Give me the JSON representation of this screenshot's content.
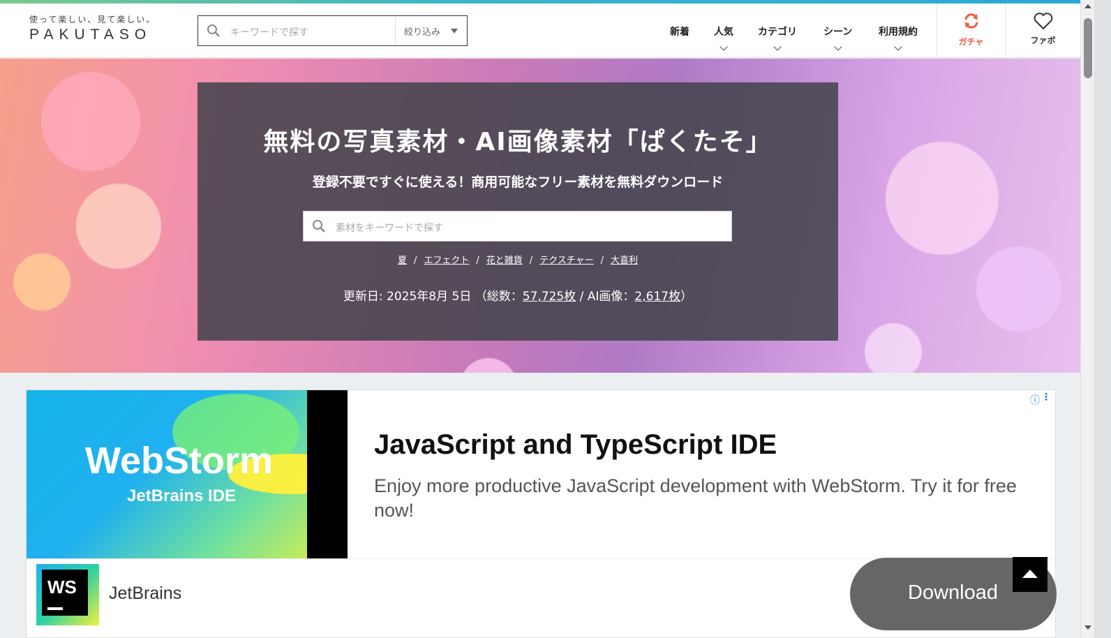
{
  "header": {
    "logo_tagline": "使って楽しい、見て楽しい。",
    "logo_name": "PAKUTASO",
    "search_placeholder": "キーワードで探す",
    "filter_label": "絞り込み",
    "nav": [
      {
        "label": "新着",
        "has_dropdown": false
      },
      {
        "label": "人気",
        "has_dropdown": true
      },
      {
        "label": "カテゴリ",
        "has_dropdown": true
      },
      {
        "label": "シーン",
        "has_dropdown": true
      },
      {
        "label": "利用規約",
        "has_dropdown": true
      }
    ],
    "gacha_label": "ガチャ",
    "fav_label": "ファボ",
    "accent_color": "#ef5a3c"
  },
  "hero": {
    "title": "無料の写真素材・AI画像素材「ぱくたそ」",
    "subtitle": "登録不要ですぐに使える！商用可能なフリー素材を無料ダウンロード",
    "search_placeholder": "素材をキーワードで探す",
    "tags": [
      "夏",
      "エフェクト",
      "花と雑貨",
      "テクスチャー",
      "大喜利"
    ],
    "update_prefix": "更新日: 2025年8月 5日 （総数：",
    "total_count": "57,725枚",
    "ai_prefix": " / AI画像：",
    "ai_count": "2,617枚",
    "update_suffix": "）"
  },
  "ad": {
    "image_title": "WebStorm",
    "image_subtitle": "JetBrains IDE",
    "headline": "JavaScript and TypeScript IDE",
    "description": "Enjoy more productive JavaScript development with WebStorm. Try it for free now!",
    "logo_text": "WS",
    "brand": "JetBrains",
    "cta": "Download"
  }
}
